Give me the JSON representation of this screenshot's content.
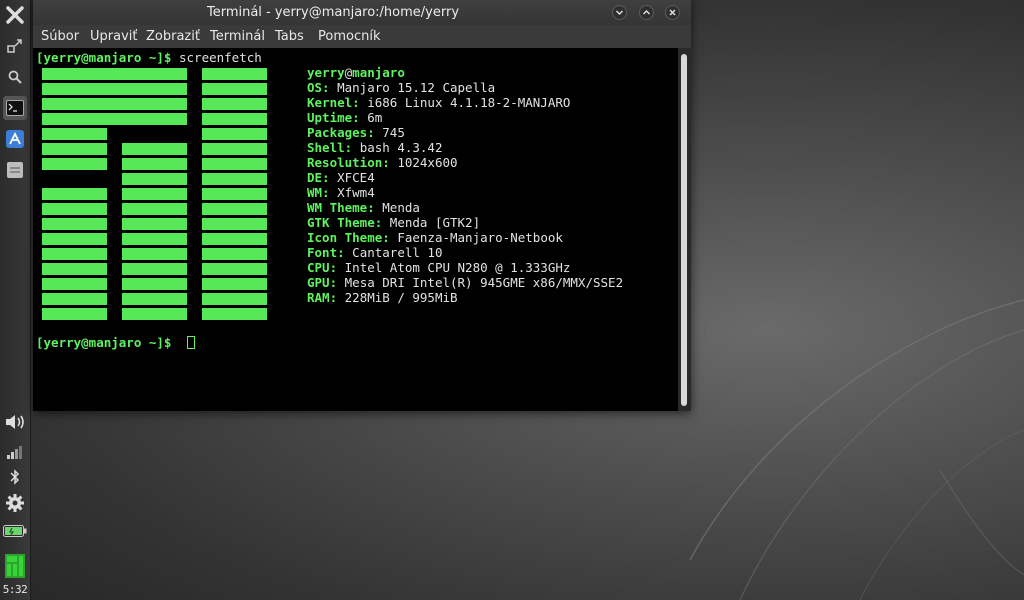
{
  "window": {
    "title": "Terminál - yerry@manjaro:/home/yerry"
  },
  "menu": [
    "Súbor",
    "Upraviť",
    "Zobraziť",
    "Terminál",
    "Tabs",
    "Pomocník"
  ],
  "terminal": {
    "prompt": "[yerry@manjaro ~]$",
    "command": "screenfetch",
    "user": "yerry",
    "at": "@",
    "host": "manjaro",
    "info": [
      {
        "key": "OS:",
        "value": "Manjaro 15.12 Capella"
      },
      {
        "key": "Kernel:",
        "value": "i686 Linux 4.1.18-2-MANJARO"
      },
      {
        "key": "Uptime:",
        "value": "6m"
      },
      {
        "key": "Packages:",
        "value": "745"
      },
      {
        "key": "Shell:",
        "value": "bash 4.3.42"
      },
      {
        "key": "Resolution:",
        "value": "1024x600"
      },
      {
        "key": "DE:",
        "value": "XFCE4"
      },
      {
        "key": "WM:",
        "value": "Xfwm4"
      },
      {
        "key": "WM Theme:",
        "value": "Menda"
      },
      {
        "key": "GTK Theme:",
        "value": "Menda [GTK2]"
      },
      {
        "key": "Icon Theme:",
        "value": "Faenza-Manjaro-Netbook"
      },
      {
        "key": "Font:",
        "value": "Cantarell 10"
      },
      {
        "key": "CPU:",
        "value": "Intel Atom CPU N280 @ 1.333GHz"
      },
      {
        "key": "GPU:",
        "value": "Mesa DRI Intel(R) 945GME x86/MMX/SSE2"
      },
      {
        "key": "RAM:",
        "value": "228MiB / 995MiB"
      }
    ]
  },
  "panel": {
    "clock": "5:32",
    "icons": [
      "close-icon",
      "resize-icon",
      "search-icon",
      "terminal-icon",
      "app-finder-icon",
      "files-icon",
      "volume-icon",
      "network-signal-icon",
      "bluetooth-icon",
      "settings-gear-icon",
      "battery-icon",
      "manjaro-logo-icon"
    ],
    "accent": "#5ef25e"
  }
}
